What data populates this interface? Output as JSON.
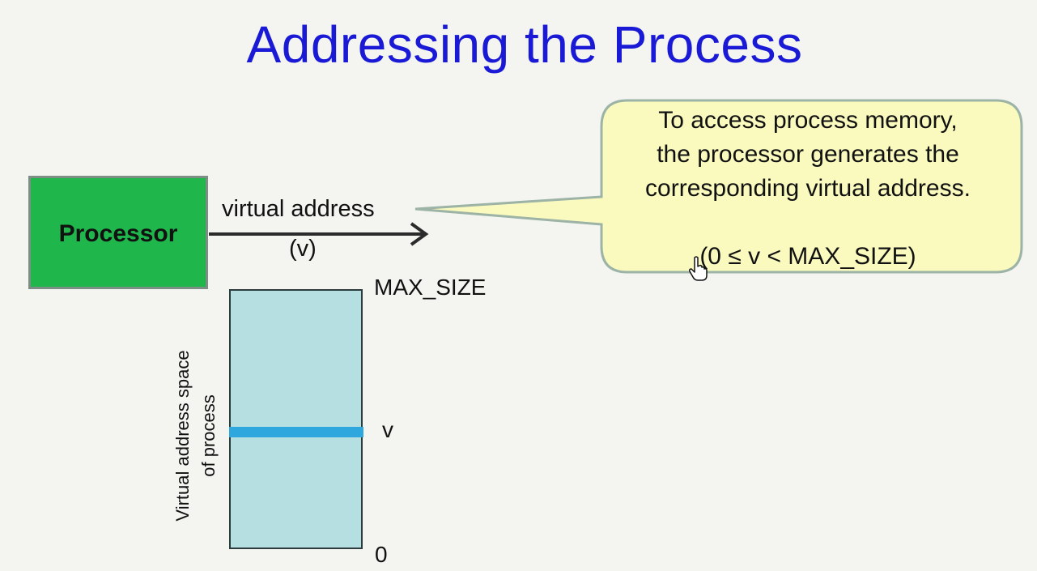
{
  "slide": {
    "title": "Addressing the Process"
  },
  "processor": {
    "label": "Processor"
  },
  "arrow": {
    "label_line1": "virtual address",
    "label_line2": "(v)"
  },
  "callout": {
    "lines": [
      "To access process memory,",
      "the processor generates the",
      "corresponding virtual address."
    ],
    "formula": "(0 ≤ v < MAX_SIZE)"
  },
  "memory": {
    "top_label": "MAX_SIZE",
    "marker_label": "v",
    "bottom_label": "0",
    "side_label_line1": "Virtual address space",
    "side_label_line2": "of process",
    "marker_fraction": 0.45
  },
  "colors": {
    "title": "#1a1ad6",
    "processor_fill": "#1fb74b",
    "memory_fill": "#b5dfe0",
    "marker": "#2ea7df",
    "callout_fill": "#fafabf"
  }
}
